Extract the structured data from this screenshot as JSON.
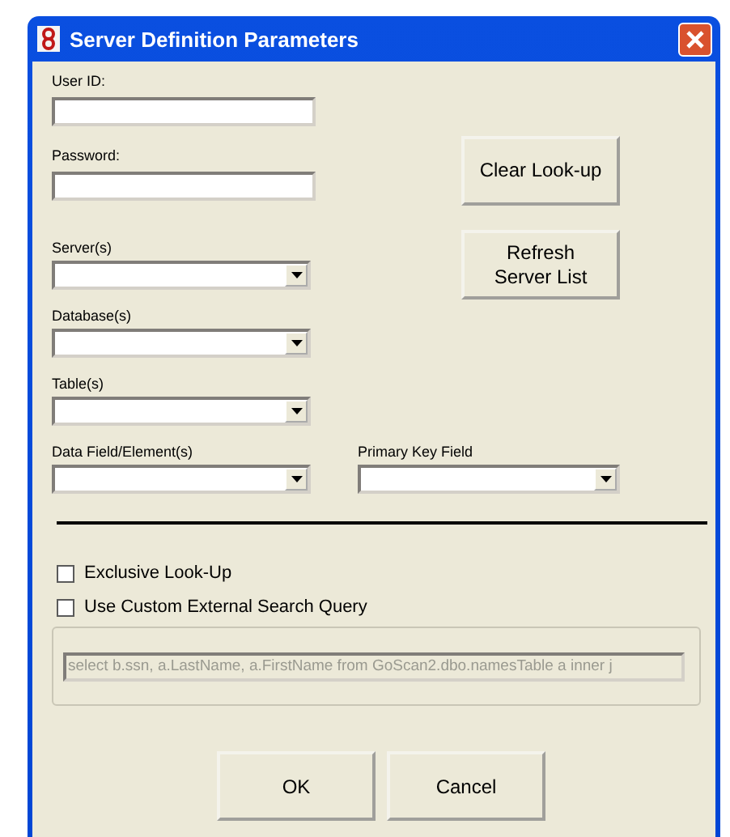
{
  "window": {
    "title": "Server Definition Parameters"
  },
  "text_fields": [
    {
      "label": "User ID:"
    },
    {
      "label": "Password:"
    }
  ],
  "combos": [
    {
      "label": "Server(s)"
    },
    {
      "label": "Database(s)"
    },
    {
      "label": "Table(s)"
    }
  ],
  "bottom_combos": [
    {
      "label": "Data Field/Element(s)"
    },
    {
      "label": "Primary Key Field"
    }
  ],
  "side_buttons": [
    "Clear Look-up",
    "Refresh\nServer List"
  ],
  "checkboxes": [
    {
      "label": "Exclusive Look-Up",
      "checked": false
    },
    {
      "label": "Use Custom External Search Query",
      "checked": false
    }
  ],
  "query": {
    "value": "select b.ssn, a.LastName, a.FirstName from GoScan2.dbo.namesTable a inner j",
    "disabled": true
  },
  "buttons": [
    "OK",
    "Cancel"
  ]
}
